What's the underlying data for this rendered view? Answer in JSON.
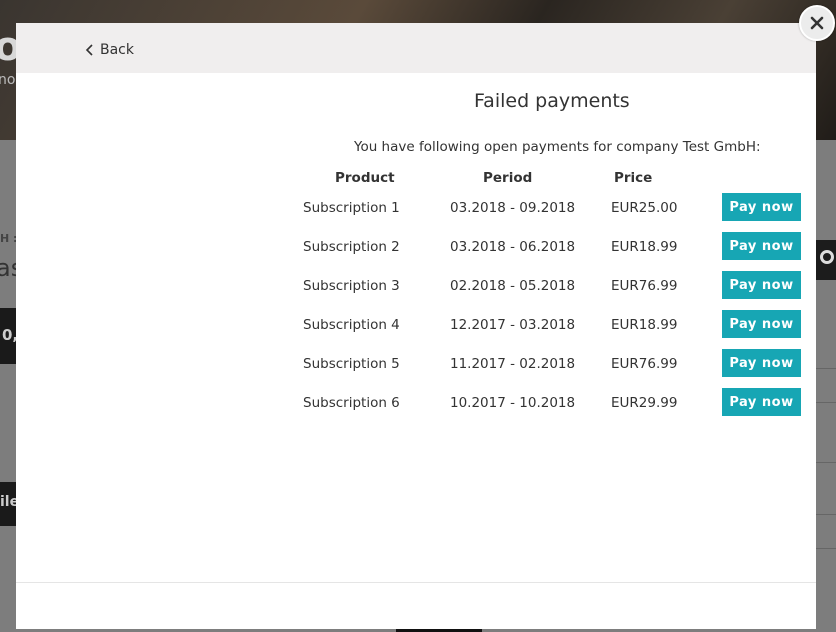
{
  "modal": {
    "back_label": "Back",
    "title": "Failed payments",
    "intro": "You have following open payments for company Test GmbH:",
    "columns": {
      "product": "Product",
      "period": "Period",
      "price": "Price"
    },
    "pay_label": "Pay now",
    "payments": [
      {
        "product": "Subscription 1",
        "period": "03.2018 - 09.2018",
        "price": "EUR25.00"
      },
      {
        "product": "Subscription 2",
        "period": "03.2018 - 06.2018",
        "price": "EUR18.99"
      },
      {
        "product": "Subscription 3",
        "period": "02.2018 - 05.2018",
        "price": "EUR76.99"
      },
      {
        "product": "Subscription 4",
        "period": "12.2017 - 03.2018",
        "price": "EUR18.99"
      },
      {
        "product": "Subscription 5",
        "period": "11.2017 - 02.2018",
        "price": "EUR76.99"
      },
      {
        "product": "Subscription 6",
        "period": "10.2017 - 10.2018",
        "price": "EUR29.99"
      }
    ]
  },
  "background": {
    "hero_letter": "o",
    "hero_sub": "no",
    "left_small": "H :",
    "left_large": "as",
    "dark_1": "0,",
    "dark_2": "ile"
  },
  "colors": {
    "accent": "#17a6b4",
    "header_bg": "#f0eeee"
  },
  "icons": {
    "back": "chevron-left-icon",
    "close": "close-icon",
    "background_search": "search-icon"
  }
}
